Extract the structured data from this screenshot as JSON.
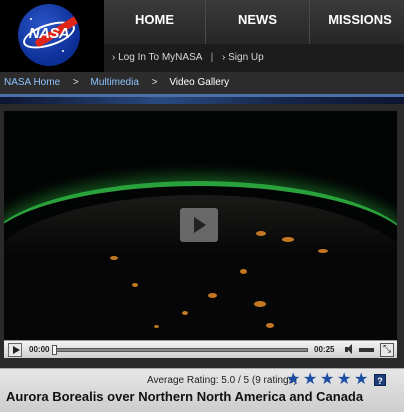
{
  "header": {
    "logo_text": "NASA",
    "nav": [
      "HOME",
      "NEWS",
      "MISSIONS"
    ],
    "login_link": "› Log In To MyNASA",
    "separator": "|",
    "signup_link": "› Sign Up"
  },
  "breadcrumb": {
    "items": [
      "NASA Home",
      "Multimedia",
      "Video Gallery"
    ],
    "arrow": ">"
  },
  "player": {
    "current_time": "00:00",
    "duration": "00:25",
    "progress": 0,
    "fullscreen_glyph": "⤡"
  },
  "video": {
    "rating_text": "Average Rating: 5.0 / 5 (9 ratings)",
    "stars_filled": 5,
    "stars_total": 5,
    "help_glyph": "?",
    "title": "Aurora Borealis over Northern North America and Canada"
  },
  "colors": {
    "link": "#8ec2ff",
    "star": "#1c4ea6",
    "aurora": "#30be46",
    "city_lights": "#e68c28"
  }
}
